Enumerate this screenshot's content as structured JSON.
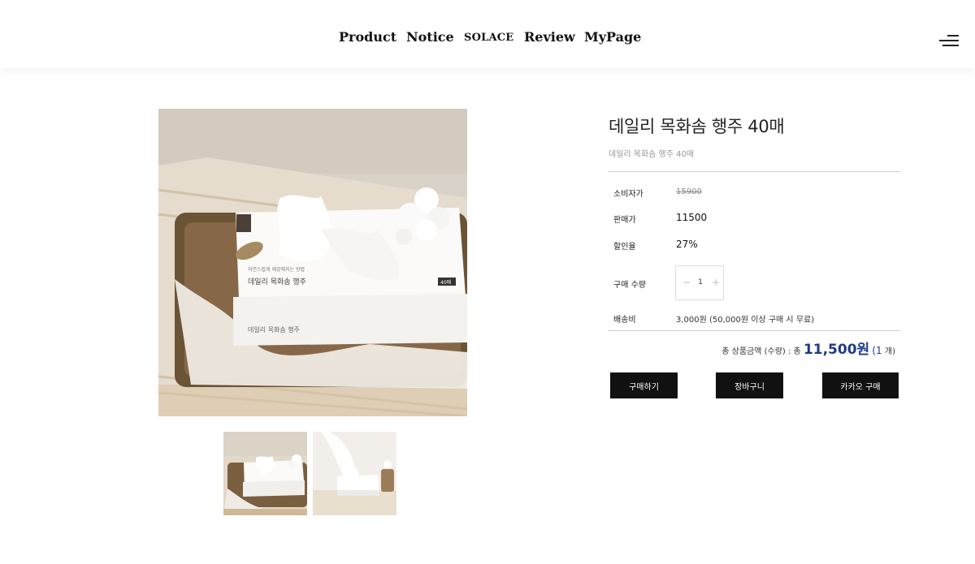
{
  "nav": {
    "product": "Product",
    "notice": "Notice",
    "logo": "SOLACE",
    "review": "Review",
    "mypage": "MyPage"
  },
  "product": {
    "title": "데일리 목화솜 행주 40매",
    "subtitle": "데일리 목화솜 행주 40매",
    "labels": {
      "consumer_price": "소비자가",
      "sale_price": "판매가",
      "discount": "할인율",
      "quantity": "구매 수량",
      "shipping": "배송비"
    },
    "consumer_price": "15900",
    "sale_price": "11500",
    "discount": "27%",
    "quantity": "1",
    "quantity_minus": "−",
    "quantity_plus": "+",
    "shipping": "3,000원 (50,000원 이상 구매 시 무료)"
  },
  "total": {
    "label": "총 상품금액 (수량) : 총",
    "amount": "11,500원",
    "count_open": "(1",
    "count_unit": "개)"
  },
  "buttons": {
    "buy": "구매하기",
    "cart": "장바구니",
    "kakao": "카카오 구매"
  },
  "box_print": {
    "name": "데일리 목화솜 행주",
    "tagline": "자연스럽게 깨끗해지는 방법",
    "tag": "40매"
  },
  "colors": {
    "accent": "#1f3a8a",
    "button": "#111111"
  }
}
